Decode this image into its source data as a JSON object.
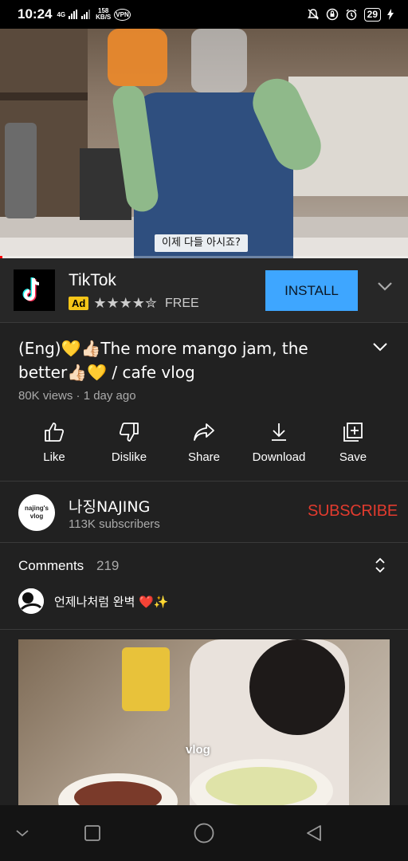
{
  "status_bar": {
    "time": "10:24",
    "network": "4G",
    "speed_value": "158",
    "speed_unit": "KB/S",
    "vpn": "VPN",
    "battery": "29"
  },
  "video": {
    "subtitle": "이제 다들 아시죠?",
    "progress_percent": 0.5
  },
  "ad": {
    "app_name": "TikTok",
    "badge": "Ad",
    "rating": 4.5,
    "stars": "★★★★✮",
    "price": "FREE",
    "install_label": "INSTALL"
  },
  "video_info": {
    "title": "(Eng)💛👍🏻The more mango jam, the better👍🏻💛 / cafe vlog",
    "meta": "80K views · 1 day ago"
  },
  "actions": [
    {
      "label": "Like",
      "icon": "thumb-up-icon"
    },
    {
      "label": "Dislike",
      "icon": "thumb-down-icon"
    },
    {
      "label": "Share",
      "icon": "share-icon"
    },
    {
      "label": "Download",
      "icon": "download-icon"
    },
    {
      "label": "Save",
      "icon": "add-to-playlist-icon"
    }
  ],
  "channel": {
    "avatar_text": "najing's vlog",
    "name": "나징NAJING",
    "subscribers": "113K subscribers",
    "subscribe_label": "SUBSCRIBE"
  },
  "comments": {
    "header": "Comments",
    "count": "219",
    "top_comment": "언제나처럼 완벽 ❤️✨"
  },
  "next_video": {
    "watermark": "vlog"
  },
  "colors": {
    "background": "#212121",
    "accent_install": "#3ea6ff",
    "subscribe": "#e23b2e",
    "ad_badge": "#f5c518"
  }
}
